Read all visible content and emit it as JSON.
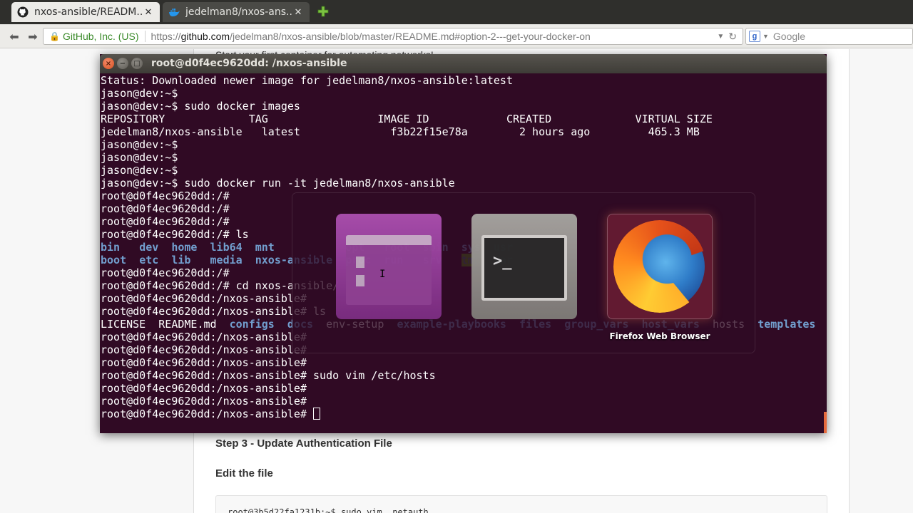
{
  "browser": {
    "tabs": [
      {
        "label": "nxos-ansible/READM...",
        "active": true
      },
      {
        "label": "jedelman8/nxos-ans...",
        "active": false
      }
    ],
    "tab_close_glyph": "✕",
    "identity": "GitHub, Inc. (US)",
    "url_scheme": "https://",
    "url_host": "github.com",
    "url_path": "/jedelman8/nxos-ansible/blob/master/README.md#option-2---get-your-docker-on",
    "search_placeholder": "Google",
    "search_engine_glyph": "g"
  },
  "article": {
    "partially_hidden_text": "Start your first container for automating networks!",
    "step_heading": "Step 3 - Update Authentication File",
    "subheading": "Edit the file",
    "code_line": "root@3b5d22fa1231b:~$ sudo vim .netauth"
  },
  "terminal": {
    "title": "root@d0f4ec9620dd: /nxos-ansible",
    "buttons": {
      "close": "×",
      "minimize": "−",
      "maximize": "□"
    },
    "lines": [
      "Status: Downloaded newer image for jedelman8/nxos-ansible:latest",
      "jason@dev:~$",
      "jason@dev:~$ sudo docker images",
      "REPOSITORY             TAG                 IMAGE ID            CREATED             VIRTUAL SIZE",
      "jedelman8/nxos-ansible   latest              f3b22f15e78a        2 hours ago         465.3 MB",
      "jason@dev:~$",
      "jason@dev:~$",
      "jason@dev:~$",
      "jason@dev:~$ sudo docker run -it jedelman8/nxos-ansible",
      "root@d0f4ec9620dd:/#",
      "root@d0f4ec9620dd:/#",
      "root@d0f4ec9620dd:/#",
      "root@d0f4ec9620dd:/# ls"
    ],
    "ls_root_row1": [
      {
        "t": "bin",
        "col": 0
      },
      {
        "t": "dev",
        "col": 6
      },
      {
        "t": "home",
        "col": 11
      },
      {
        "t": "lib64",
        "col": 17
      },
      {
        "t": "mnt",
        "col": 24
      },
      {
        "t": "opt",
        "col": 38
      },
      {
        "t": "root",
        "col": 44
      },
      {
        "t": "sbin",
        "col": 50
      },
      {
        "t": "sys",
        "col": 56
      },
      {
        "t": "usr",
        "col": 61
      }
    ],
    "ls_root_row2": [
      {
        "t": "boot",
        "col": 0
      },
      {
        "t": "etc",
        "col": 6
      },
      {
        "t": "lib",
        "col": 11
      },
      {
        "t": "media",
        "col": 17
      },
      {
        "t": "nxos-ansible",
        "col": 24
      },
      {
        "t": "proc",
        "col": 38
      },
      {
        "t": "run",
        "col": 44
      },
      {
        "t": "srv",
        "col": 50
      },
      {
        "t": "tmp",
        "col": 56,
        "hl": true
      },
      {
        "t": "var",
        "col": 61
      }
    ],
    "lines_after": [
      "root@d0f4ec9620dd:/#",
      "root@d0f4ec9620dd:/# cd nxos-ansible/",
      "root@d0f4ec9620dd:/nxos-ansible#",
      "root@d0f4ec9620dd:/nxos-ansible# ls"
    ],
    "ls_repo_row": [
      {
        "t": "LICENSE",
        "col": 0,
        "dir": false
      },
      {
        "t": "README.md",
        "col": 9,
        "dir": false
      },
      {
        "t": "configs",
        "col": 20,
        "dir": true
      },
      {
        "t": "docs",
        "col": 29,
        "dir": true
      },
      {
        "t": "env-setup",
        "col": 35,
        "dir": false
      },
      {
        "t": "example-playbooks",
        "col": 46,
        "dir": true
      },
      {
        "t": "files",
        "col": 65,
        "dir": true
      },
      {
        "t": "group_vars",
        "col": 72,
        "dir": true
      },
      {
        "t": "host_vars",
        "col": 84,
        "dir": true
      },
      {
        "t": "hosts",
        "col": 95,
        "dir": false
      },
      {
        "t": "templates",
        "col": 102,
        "dir": true
      }
    ],
    "lines_end": [
      "root@d0f4ec9620dd:/nxos-ansible#",
      "root@d0f4ec9620dd:/nxos-ansible#",
      "root@d0f4ec9620dd:/nxos-ansible#",
      "root@d0f4ec9620dd:/nxos-ansible# sudo vim /etc/hosts",
      "root@d0f4ec9620dd:/nxos-ansible#",
      "root@d0f4ec9620dd:/nxos-ansible#",
      "root@d0f4ec9620dd:/nxos-ansible# "
    ],
    "colors": {
      "background": "#300a24",
      "text": "#ffffff",
      "directory": "#729fcf",
      "highlight_bg": "#4e9a06"
    }
  },
  "switcher": {
    "apps": [
      {
        "id": "files",
        "icon": "files-icon"
      },
      {
        "id": "terminal",
        "icon": "terminal-icon",
        "glyph": ">_"
      },
      {
        "id": "firefox",
        "icon": "firefox-icon"
      }
    ],
    "selected_label": "Firefox Web Browser"
  }
}
